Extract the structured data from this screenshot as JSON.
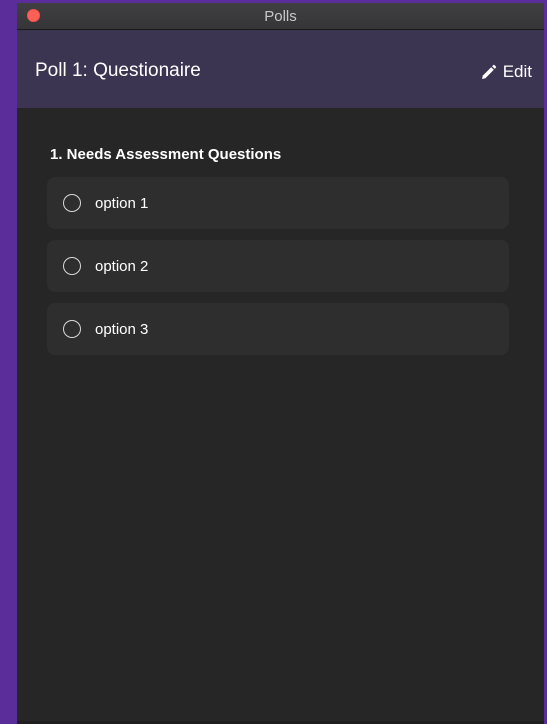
{
  "window": {
    "title": "Polls"
  },
  "header": {
    "poll_title": "Poll 1: Questionaire",
    "edit_label": "Edit"
  },
  "question": {
    "title": "1. Needs Assessment Questions",
    "options": [
      {
        "label": "option 1"
      },
      {
        "label": "option 2"
      },
      {
        "label": "option 3"
      }
    ]
  },
  "colors": {
    "desktop": "#5b2d9a",
    "header_bg": "#3b3552",
    "panel_bg": "#262626",
    "option_bg": "#2e2e2e",
    "close_button": "#fe5f57"
  },
  "icons": {
    "close": "close-icon",
    "edit": "pencil-icon",
    "radio": "radio-icon"
  }
}
